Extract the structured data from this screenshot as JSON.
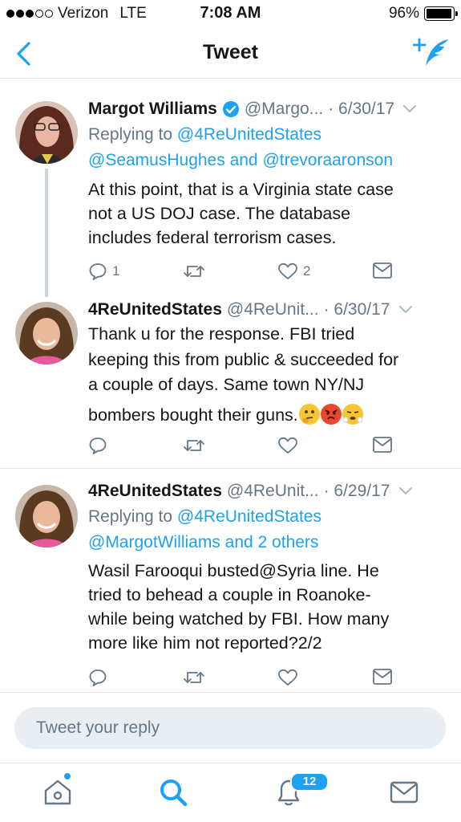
{
  "status_bar": {
    "carrier": "Verizon",
    "network": "LTE",
    "time": "7:08 AM",
    "battery": "96%",
    "battery_level": 0.96,
    "signal_bars_filled": 3,
    "signal_bars_total": 5
  },
  "nav": {
    "title": "Tweet",
    "back_icon": "chevron-left-icon",
    "compose_icon": "compose-tweet-icon"
  },
  "colors": {
    "accent": "#1da1f2",
    "secondary_text": "#657786",
    "divider": "#e1e8ed",
    "thread_line": "#ccd6dd"
  },
  "tweets": [
    {
      "name": "Margot Williams",
      "verified": true,
      "handle": "@Margo...",
      "date": "· 6/30/17",
      "reply_prefix": "Replying to",
      "reply_to": "@4ReUnitedStates",
      "reply_line2": "@SeamusHughes and @trevoraaronson",
      "text_lines": [
        "At this point, that is a Virginia state case",
        "not a US DOJ case. The database",
        "includes federal terrorism cases."
      ],
      "replies": "1",
      "retweets": "",
      "likes": "2"
    },
    {
      "name": "4ReUnitedStates",
      "verified": false,
      "handle": "@4ReUnit...",
      "date": "· 6/30/17",
      "text_lines": [
        "Thank u for the response. FBI tried",
        "keeping this from public & succeeded for",
        "a couple of days. Same town NY/NJ",
        "bombers bought their guns."
      ],
      "emojis": [
        "thinking-face-emoji",
        "pouting-face-emoji",
        "triumph-face-emoji"
      ],
      "replies": "",
      "retweets": "",
      "likes": ""
    },
    {
      "name": "4ReUnitedStates",
      "verified": false,
      "handle": "@4ReUnit...",
      "date": "· 6/29/17",
      "reply_prefix": "Replying to",
      "reply_to": "@4ReUnitedStates",
      "reply_line2": "@MargotWilliams and 2 others",
      "text_lines": [
        "Wasil Farooqui busted@Syria line. He",
        "tried to behead a couple in Roanoke-",
        "while being watched by FBI. How many",
        "more like him not reported?2/2"
      ],
      "replies": "",
      "retweets": "",
      "likes": ""
    }
  ],
  "reply_box": {
    "placeholder": "Tweet your reply"
  },
  "tabbar": {
    "home": "home-icon",
    "search": "search-icon",
    "notifications": "bell-icon",
    "messages": "envelope-icon",
    "notification_count": "12"
  }
}
